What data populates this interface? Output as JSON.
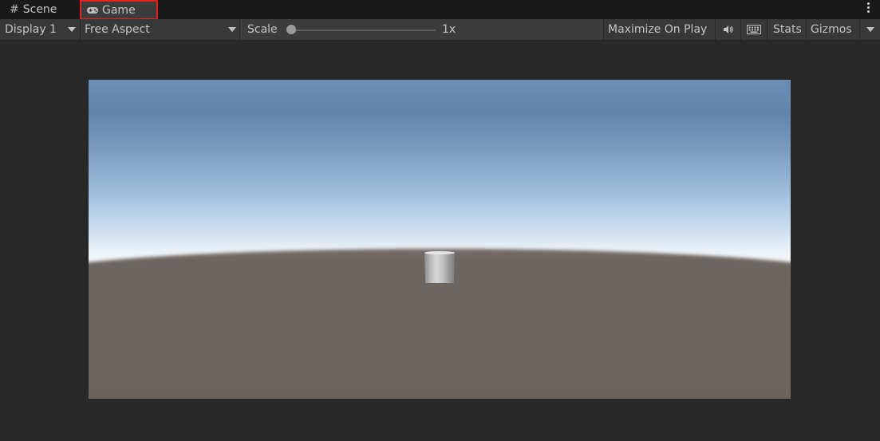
{
  "tabs": {
    "scene": {
      "label": "Scene",
      "icon": "grid-icon"
    },
    "game": {
      "label": "Game",
      "icon": "gamepad-icon",
      "highlight_color": "#e8201a"
    }
  },
  "toolbar": {
    "display_label": "Display 1",
    "aspect_label": "Free Aspect",
    "scale_label": "Scale",
    "scale_value": "1x",
    "maximize_label": "Maximize On Play",
    "audio_icon": "speaker-icon",
    "keyboard_icon": "keyboard-icon",
    "stats_label": "Stats",
    "gizmos_label": "Gizmos"
  },
  "colors": {
    "tab_bar": "#191919",
    "toolbar": "#3c3c3c",
    "background": "#282828",
    "sky_top": "#6d8fb7",
    "horizon": "#f4f6f6",
    "ground": "#6c645e"
  }
}
